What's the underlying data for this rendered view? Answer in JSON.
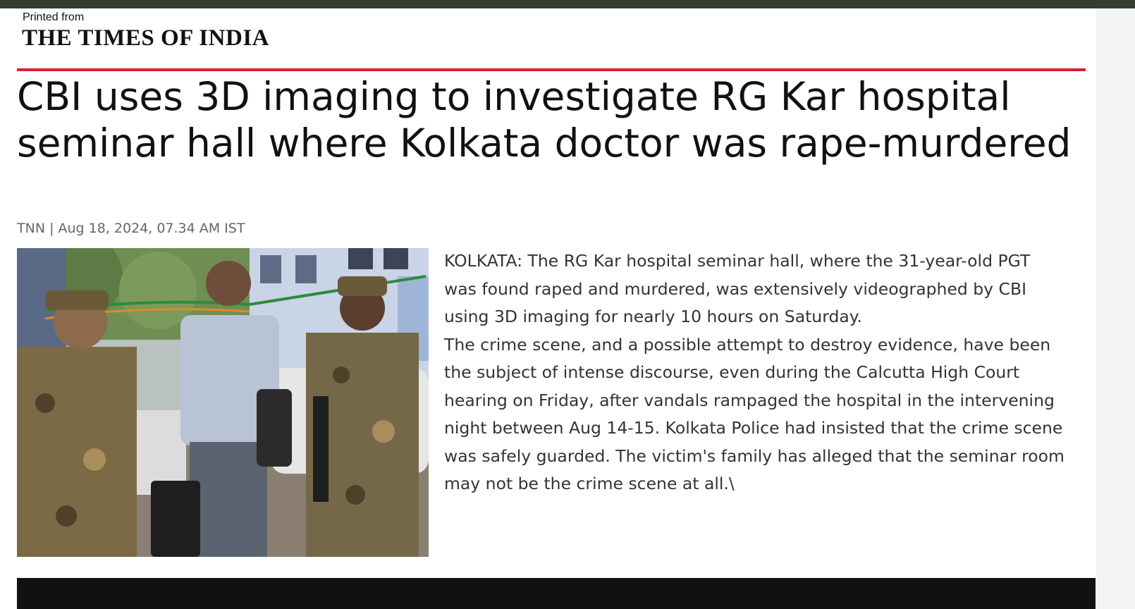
{
  "header": {
    "printed_from": "Printed from",
    "masthead": "THE TIMES OF INDIA"
  },
  "article": {
    "headline": "CBI uses 3D imaging to investigate RG Kar hospital seminar hall where Kolkata doctor was rape-murdered",
    "byline": "TNN | Aug 18, 2024, 07.34 AM IST",
    "paragraphs": [
      "KOLKATA: The RG Kar hospital seminar hall, where the 31-year-old PGT was found raped and murdered, was extensively videographed by CBI using 3D imaging for nearly 10 hours on Saturday.",
      "The crime scene, and a possible attempt to destroy evidence, have been the subject of intense discourse, even during the Calcutta High Court hearing on Friday, after vandals rampaged the hospital in the intervening night between Aug 14-15. Kolkata Police had insisted that the crime scene was safely guarded. The victim's family has alleged that the seminar room may not be the crime scene at all.\\"
    ]
  },
  "colors": {
    "accent_red": "#d81e2e",
    "top_bar": "#343d2e",
    "bottom_bar": "#111111"
  }
}
